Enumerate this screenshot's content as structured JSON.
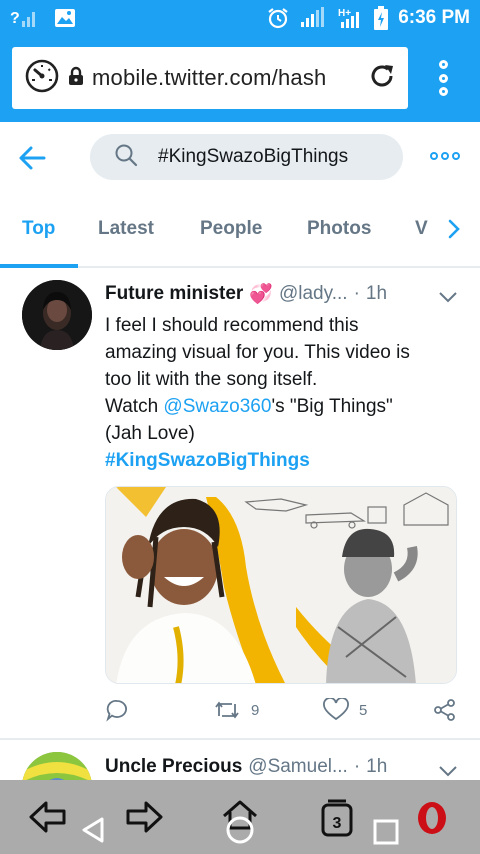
{
  "status_bar": {
    "time": "6:36 PM",
    "signal_label": "?",
    "network_label": "H+"
  },
  "browser": {
    "url": "mobile.twitter.com/hash",
    "tab_count": "3"
  },
  "search": {
    "query": "#KingSwazoBigThings"
  },
  "tabs": [
    {
      "label": "Top",
      "active": true
    },
    {
      "label": "Latest",
      "active": false
    },
    {
      "label": "People",
      "active": false
    },
    {
      "label": "Photos",
      "active": false
    },
    {
      "label": "V",
      "active": false
    }
  ],
  "tweet": {
    "author": "Future minister",
    "emoji": "💞",
    "handle": "@lady...",
    "separator": "·",
    "time": "1h",
    "text_line1": "I feel I should recommend this",
    "text_line2": "amazing visual for you. This video is",
    "text_line3": "too lit with the song itself.",
    "text_watch": "Watch ",
    "mention": "@Swazo360",
    "text_after_mention": "'s \"Big Things\"",
    "text_line5": "(Jah Love)",
    "hashtag": "#KingSwazoBigThings",
    "retweets": "9",
    "likes": "5"
  },
  "tweet2": {
    "author": "Uncle Precious",
    "handle": "@Samuel...",
    "separator": "·",
    "time": "1h"
  },
  "colors": {
    "accent": "#1da1f2",
    "secondary_text": "#657786",
    "nav_bar": "#ababab",
    "opera_red": "#cc0f16"
  }
}
